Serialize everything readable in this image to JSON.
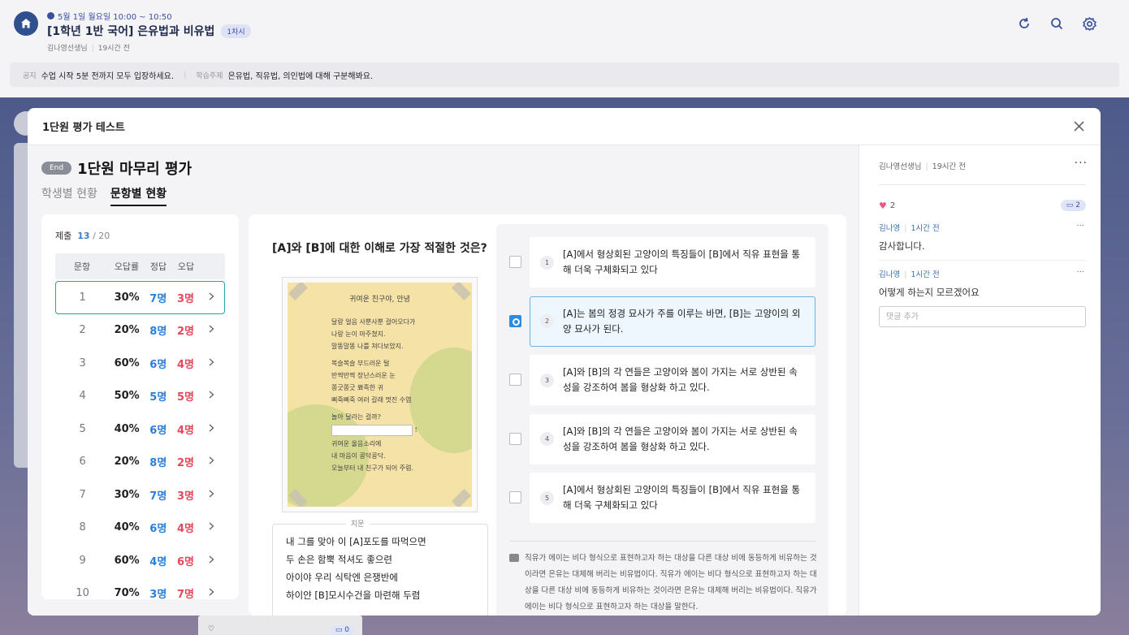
{
  "header": {
    "datetime": "5월 1일 월요일 10:00 ~ 10:50",
    "title": "[1학년 1반 국어] 은유법과 비유법",
    "session": "1차시",
    "teacher": "김나영선생님",
    "posted": "19시간 전",
    "icons": [
      "refresh-icon",
      "search-icon",
      "settings-icon"
    ]
  },
  "notice": {
    "notice_label": "공지",
    "notice_text": "수업 시작 5분 전까지 모두 입장하세요.",
    "topic_label": "학습주제",
    "topic_text": "은유법, 직유법, 의인법에 대해 구분해봐요."
  },
  "modal": {
    "title": "1단원 평가 테스트",
    "status_badge": "End",
    "eval_name": "1단원 마무리 평가",
    "tabs": [
      {
        "label": "학생별 현황",
        "active": false
      },
      {
        "label": "문항별 현황",
        "active": true
      }
    ]
  },
  "stats": {
    "submit_label": "제출",
    "submitted": "13",
    "total": "/ 20",
    "headers": [
      "문항",
      "오답률",
      "정답",
      "오답"
    ],
    "rows": [
      {
        "q": "1",
        "rate": "30%",
        "correct": "7명",
        "wrong": "3명"
      },
      {
        "q": "2",
        "rate": "20%",
        "correct": "8명",
        "wrong": "2명"
      },
      {
        "q": "3",
        "rate": "60%",
        "correct": "6명",
        "wrong": "4명"
      },
      {
        "q": "4",
        "rate": "50%",
        "correct": "5명",
        "wrong": "5명"
      },
      {
        "q": "5",
        "rate": "40%",
        "correct": "6명",
        "wrong": "4명"
      },
      {
        "q": "6",
        "rate": "20%",
        "correct": "8명",
        "wrong": "2명"
      },
      {
        "q": "7",
        "rate": "30%",
        "correct": "7명",
        "wrong": "3명"
      },
      {
        "q": "8",
        "rate": "40%",
        "correct": "6명",
        "wrong": "4명"
      },
      {
        "q": "9",
        "rate": "60%",
        "correct": "4명",
        "wrong": "6명"
      },
      {
        "q": "10",
        "rate": "70%",
        "correct": "3명",
        "wrong": "7명"
      }
    ]
  },
  "question": {
    "title": "[A]와 [B]에 대한 이해로 가장 적절한 것은?",
    "poem": {
      "title": "귀여운 친구야, 안녕",
      "lines1": [
        "달랑 얼음 사뿐사뿐 걸어오다가",
        "나랑 눈이 마주쳤지.",
        "말똥말똥 나를 쳐다보았지."
      ],
      "lines2": [
        "복슬복슬 부드러운 털",
        "반짝반짝 장난스러운 눈",
        "쫑긋쫑긋 뾰족한 귀",
        "삐죽삐죽 여러 갈래 멋진 수염"
      ],
      "q_line": "놀아 달라는 걸까?",
      "blank_suffix": "!",
      "lines3": [
        "귀여운 울음소리에",
        "내 마음이 콩닥콩닥.",
        "오늘부터 내 친구가 되어 주렴."
      ]
    },
    "passage_label": "지문",
    "passage": [
      "내 그를 맞아 이 [A]포도를 따먹으면",
      "두 손은 함뿍 적셔도 좋으련",
      "아이야 우리 식탁엔 은쟁반에",
      "하이얀 [B]모시수건을 마련해 두렴"
    ],
    "choices": [
      {
        "num": "1",
        "text": "[A]에서 형상회된 고양이의 특징들이 [B]에서 직유 표현을 통해 더욱 구체화되고 있다",
        "checked": false
      },
      {
        "num": "2",
        "text": "[A]는 봄의 정경 묘사가 주를 이루는 바면, [B]는 고양이의 외양 묘사가 된다.",
        "checked": true
      },
      {
        "num": "3",
        "text": "[A]와 [B]의 각 연들은 고양이와 봄이 가지는 서로 상반된 속성을 강조하여 봄을 형상화 하고 있다.",
        "checked": false
      },
      {
        "num": "4",
        "text": "[A]와 [B]의 각 연들은 고양이와 봄이 가지는 서로 상반된 속성을 강조하여 봄을 형상화 하고 있다.",
        "checked": false
      },
      {
        "num": "5",
        "text": "[A]에서 형상회된 고양이의 특징들이 [B]에서 직유 표현을 통해 더욱 구체화되고 있다",
        "checked": false
      }
    ],
    "explanation": "직유가 에이는 비다 형식으로 표현하고자 하는 대상을 다른 대상 비에 동등하게 비유하는 것이라면 은유는 대체해 버리는 비유법이다. 직유가 에이는 비다 형식으로 표현하고자 하는 대상을 다른 대상 비에 동등하게 비유하는 것이라면 은유는 대체해 버리는 비유법이다. 직유가 에이는 비다 형식으로 표현하고자 하는 대상을 말한다."
  },
  "side": {
    "author": "김나영선생님",
    "posted": "19시간 전",
    "likes": "2",
    "comment_count": "2",
    "comments": [
      {
        "author": "김나영",
        "time": "1시간 전",
        "text": "감사합니다."
      },
      {
        "author": "김나영",
        "time": "1시간 전",
        "text": "어떻게 하는지 모르겠어요"
      }
    ],
    "comment_placeholder": "댓글 추가"
  },
  "background": {
    "card_comment_count": "0"
  },
  "colors": {
    "accent": "#2a8de0",
    "correct": "#2a7fd9",
    "wrong": "#e5485a",
    "selected_row_border": "#27a3a3"
  }
}
